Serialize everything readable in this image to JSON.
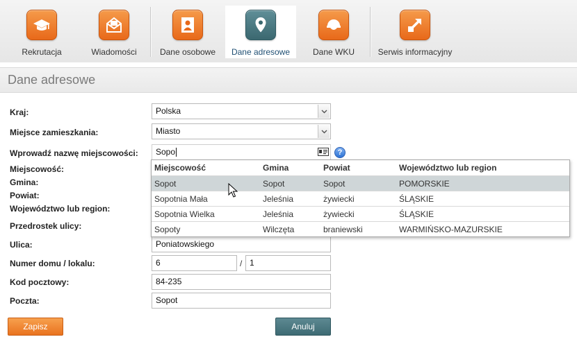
{
  "nav": {
    "items": [
      {
        "label": "Rekrutacja",
        "icon": "graduation-cap-icon"
      },
      {
        "label": "Wiadomości",
        "icon": "envelope-icon"
      },
      {
        "label": "Dane osobowe",
        "icon": "person-card-icon"
      },
      {
        "label": "Dane adresowe",
        "icon": "map-pin-icon"
      },
      {
        "label": "Dane WKU",
        "icon": "helmet-icon"
      },
      {
        "label": "Serwis informacyjny",
        "icon": "arrow-out-icon"
      }
    ],
    "active": "Dane adresowe"
  },
  "section": {
    "title": "Dane adresowe"
  },
  "form": {
    "country": {
      "label": "Kraj:",
      "value": "Polska"
    },
    "residence": {
      "label": "Miejsce zamieszkania:",
      "value": "Miasto"
    },
    "city_search": {
      "label": "Wprowadź nazwę miejscowości:",
      "value": "Sopo"
    },
    "city": {
      "label": "Miejscowość:"
    },
    "commune": {
      "label": "Gmina:"
    },
    "county": {
      "label": "Powiat:"
    },
    "voivodeship": {
      "label": "Województwo lub region:"
    },
    "street_prefix": {
      "label": "Przedrostek ulicy:"
    },
    "street": {
      "label": "Ulica:",
      "value": "Poniatowskiego"
    },
    "house_number": {
      "label": "Numer domu / lokalu:",
      "house": "6",
      "separator": "/",
      "flat": "1"
    },
    "postal_code": {
      "label": "Kod pocztowy:",
      "value": "84-235"
    },
    "post_office": {
      "label": "Poczta:",
      "value": "Sopot"
    }
  },
  "autocomplete": {
    "headers": [
      "Miejscowość",
      "Gmina",
      "Powiat",
      "Województwo lub region"
    ],
    "rows": [
      [
        "Sopot",
        "Sopot",
        "Sopot",
        "POMORSKIE"
      ],
      [
        "Sopotnia Mała",
        "Jeleśnia",
        "żywiecki",
        "ŚLĄSKIE"
      ],
      [
        "Sopotnia Wielka",
        "Jeleśnia",
        "żywiecki",
        "ŚLĄSKIE"
      ],
      [
        "Sopoty",
        "Wilczęta",
        "braniewski",
        "WARMIŃSKO-MAZURSKIE"
      ]
    ],
    "highlighted_row": 0
  },
  "buttons": {
    "save": "Zapisz",
    "cancel": "Anuluj"
  },
  "help": {
    "symbol": "?"
  },
  "colors": {
    "accent_orange": "#e9731f",
    "accent_teal": "#3e6b74",
    "highlight_row": "#cfd6d8"
  }
}
